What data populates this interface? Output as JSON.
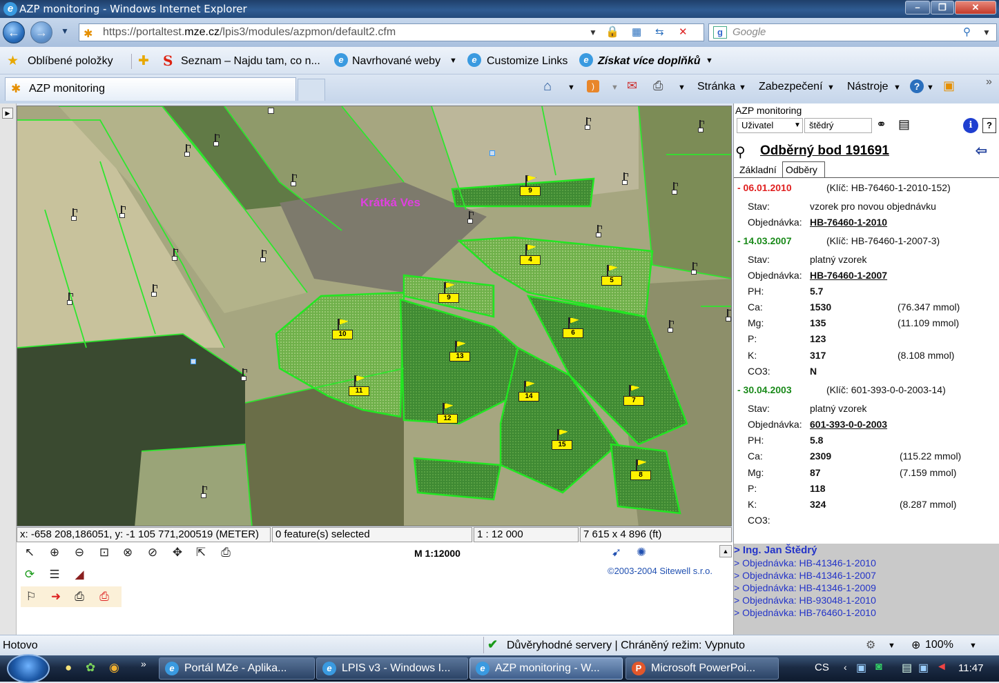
{
  "window": {
    "title": "AZP monitoring - Windows Internet Explorer"
  },
  "address": {
    "url_prefix": "https://portaltest.",
    "url_domain": "mze.cz",
    "url_path": "/lpis3/modules/azpmon/default2.cfm",
    "search_placeholder": "Google"
  },
  "favorites": {
    "label": "Oblíbené položky",
    "items": [
      "Seznam – Najdu tam, co n...",
      "Navrhované weby",
      "Customize Links",
      "Získat více doplňků"
    ]
  },
  "tabs": {
    "active": "AZP monitoring"
  },
  "toolbar": {
    "page": "Stránka",
    "security": "Zabezpečení",
    "tools": "Nástroje"
  },
  "map": {
    "village_label": "Krátká Ves",
    "status": {
      "coords": "x: -658 208,186051, y: -1 105 771,200519 (METER)",
      "selection": "0 feature(s) selected",
      "scale": "1 : 12 000",
      "extent": "7 615 x 4 896 (ft)"
    },
    "scale_text": "M 1:12000",
    "copyright": "©2003-2004 Sitewell s.r.o.",
    "flags": [
      {
        "label": "9"
      },
      {
        "label": "4"
      },
      {
        "label": "5"
      },
      {
        "label": "9"
      },
      {
        "label": "10"
      },
      {
        "label": "13"
      },
      {
        "label": "6"
      },
      {
        "label": "11"
      },
      {
        "label": "14"
      },
      {
        "label": "7"
      },
      {
        "label": "12"
      },
      {
        "label": "15"
      },
      {
        "label": "8"
      }
    ]
  },
  "panel": {
    "app_title": "AZP monitoring",
    "user_select": "Uživatel",
    "user_value": "štědrý",
    "heading": "Odběrný bod 191691",
    "tab_basic": "Základní",
    "tab_samples": "Odběry",
    "labels": {
      "state": "Stav:",
      "order": "Objednávka:",
      "ph": "PH:",
      "ca": "Ca:",
      "mg": "Mg:",
      "p": "P:",
      "k": "K:",
      "co3": "CO3:"
    },
    "samples": [
      {
        "date": "- 06.01.2010",
        "key": "(Klíč: HB-76460-1-2010-152)",
        "state": "vzorek pro novou objednávku",
        "order": "HB-76460-1-2010"
      },
      {
        "date": "- 14.03.2007",
        "key": "(Klíč: HB-76460-1-2007-3)",
        "state": "platný vzorek",
        "order": "HB-76460-1-2007",
        "ph": "5.7",
        "ca": "1530",
        "ca_mmol": "(76.347 mmol)",
        "mg": "135",
        "mg_mmol": "(11.109 mmol)",
        "p": "123",
        "k": "317",
        "k_mmol": "(8.108 mmol)",
        "co3": "N"
      },
      {
        "date": "- 30.04.2003",
        "key": "(Klíč: 601-393-0-0-2003-14)",
        "state": "platný vzorek",
        "order": "601-393-0-0-2003",
        "ph": "5.8",
        "ca": "2309",
        "ca_mmol": "(115.22 mmol)",
        "mg": "87",
        "mg_mmol": "(7.159 mmol)",
        "p": "118",
        "k": "324",
        "k_mmol": "(8.287 mmol)",
        "co3": ""
      }
    ],
    "links": [
      "> Ing. Jan Štědrý",
      "> Objednávka: HB-41346-1-2010",
      "> Objednávka: HB-41346-1-2007",
      "> Objednávka: HB-41346-1-2009",
      "> Objednávka: HB-93048-1-2010",
      "> Objednávka: HB-76460-1-2010"
    ]
  },
  "statusbar": {
    "left": "Hotovo",
    "middle": "Důvěryhodné servery | Chráněný režim: Vypnuto",
    "zoom": "100%"
  },
  "taskbar": {
    "tasks": [
      "Portál MZe - Aplika...",
      "LPIS v3 - Windows I...",
      "AZP monitoring - W...",
      "Microsoft PowerPoi..."
    ],
    "lang": "CS",
    "clock": "11:47"
  }
}
